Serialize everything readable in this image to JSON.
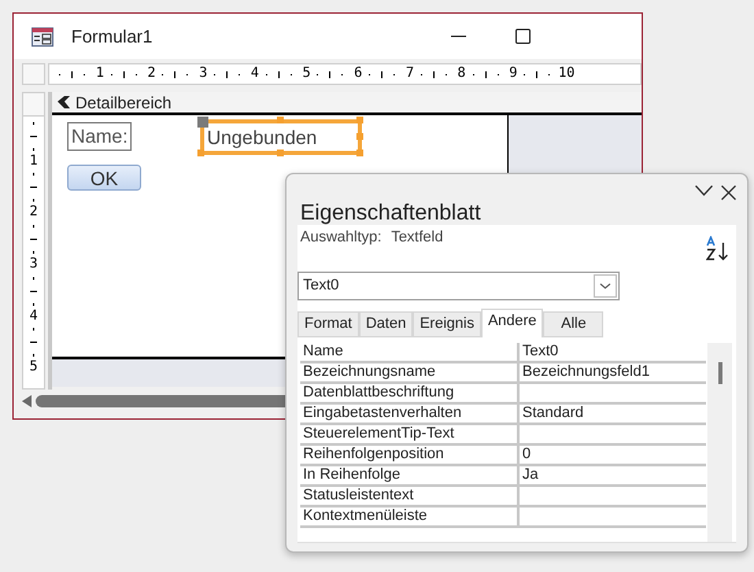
{
  "form_window": {
    "title": "Formular1",
    "ruler_h": [
      "1",
      "2",
      "3",
      "4",
      "5",
      "6",
      "7",
      "8",
      "9",
      "10"
    ],
    "ruler_v": [
      "1",
      "2",
      "3",
      "4",
      "5"
    ],
    "section": "Detailbereich",
    "controls": [
      {
        "kind": "label",
        "text": "Name:"
      },
      {
        "kind": "textbox",
        "text": "Ungebunden",
        "selected": true
      },
      {
        "kind": "button",
        "text": "OK"
      }
    ]
  },
  "property_sheet": {
    "title": "Eigenschaftenblatt",
    "selection_type_label": "Auswahltyp:",
    "selection_type": "Textfeld",
    "object": "Text0",
    "tabs": [
      {
        "label": "Format",
        "selected": false
      },
      {
        "label": "Daten",
        "selected": false
      },
      {
        "label": "Ereignis",
        "selected": false
      },
      {
        "label": "Andere",
        "selected": true
      },
      {
        "label": "Alle",
        "selected": false
      }
    ],
    "rows": [
      {
        "name": "Name",
        "value": "Text0"
      },
      {
        "name": "Bezeichnungsname",
        "value": "Bezeichnungsfeld1"
      },
      {
        "name": "Datenblattbeschriftung",
        "value": ""
      },
      {
        "name": "Eingabetastenverhalten",
        "value": "Standard"
      },
      {
        "name": "SteuerelementTip-Text",
        "value": ""
      },
      {
        "name": "Reihenfolgenposition",
        "value": "0"
      },
      {
        "name": "In Reihenfolge",
        "value": "Ja"
      },
      {
        "name": "Statusleistentext",
        "value": ""
      },
      {
        "name": "Kontextmenüleiste",
        "value": ""
      }
    ]
  }
}
